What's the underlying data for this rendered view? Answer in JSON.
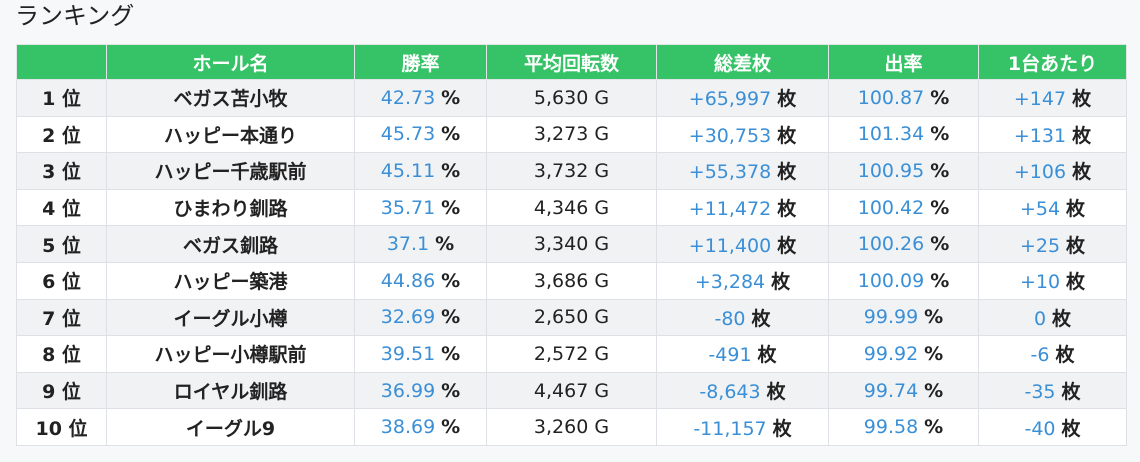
{
  "page": {
    "title": "ランキング"
  },
  "table": {
    "headers": [
      "",
      "ホール名",
      "勝率",
      "平均回転数",
      "総差枚",
      "出率",
      "1台あたり"
    ],
    "rows": [
      {
        "rank": "1 位",
        "hall": "ベガス苫小牧",
        "win_rate": "42.73",
        "avg_spins": "5,630 G",
        "total_diff": "+65,997",
        "payout": "100.87",
        "per_unit": "+147"
      },
      {
        "rank": "2 位",
        "hall": "ハッピー本通り",
        "win_rate": "45.73",
        "avg_spins": "3,273 G",
        "total_diff": "+30,753",
        "payout": "101.34",
        "per_unit": "+131"
      },
      {
        "rank": "3 位",
        "hall": "ハッピー千歳駅前",
        "win_rate": "45.11",
        "avg_spins": "3,732 G",
        "total_diff": "+55,378",
        "payout": "100.95",
        "per_unit": "+106"
      },
      {
        "rank": "4 位",
        "hall": "ひまわり釧路",
        "win_rate": "35.71",
        "avg_spins": "4,346 G",
        "total_diff": "+11,472",
        "payout": "100.42",
        "per_unit": "+54"
      },
      {
        "rank": "5 位",
        "hall": "ベガス釧路",
        "win_rate": "37.1",
        "avg_spins": "3,340 G",
        "total_diff": "+11,400",
        "payout": "100.26",
        "per_unit": "+25"
      },
      {
        "rank": "6 位",
        "hall": "ハッピー築港",
        "win_rate": "44.86",
        "avg_spins": "3,686 G",
        "total_diff": "+3,284",
        "payout": "100.09",
        "per_unit": "+10"
      },
      {
        "rank": "7 位",
        "hall": "イーグル小樽",
        "win_rate": "32.69",
        "avg_spins": "2,650 G",
        "total_diff": "-80",
        "payout": "99.99",
        "per_unit": "0"
      },
      {
        "rank": "8 位",
        "hall": "ハッピー小樽駅前",
        "win_rate": "39.51",
        "avg_spins": "2,572 G",
        "total_diff": "-491",
        "payout": "99.92",
        "per_unit": "-6"
      },
      {
        "rank": "9 位",
        "hall": "ロイヤル釧路",
        "win_rate": "36.99",
        "avg_spins": "4,467 G",
        "total_diff": "-8,643",
        "payout": "99.74",
        "per_unit": "-35"
      },
      {
        "rank": "10 位",
        "hall": "イーグル9",
        "win_rate": "38.69",
        "avg_spins": "3,260 G",
        "total_diff": "-11,157",
        "payout": "99.58",
        "per_unit": "-40"
      }
    ],
    "units": {
      "percent": "%",
      "coins": "枚"
    }
  },
  "colors": {
    "header_bg": "#36c267",
    "value_blue": "#3a8fd6"
  }
}
